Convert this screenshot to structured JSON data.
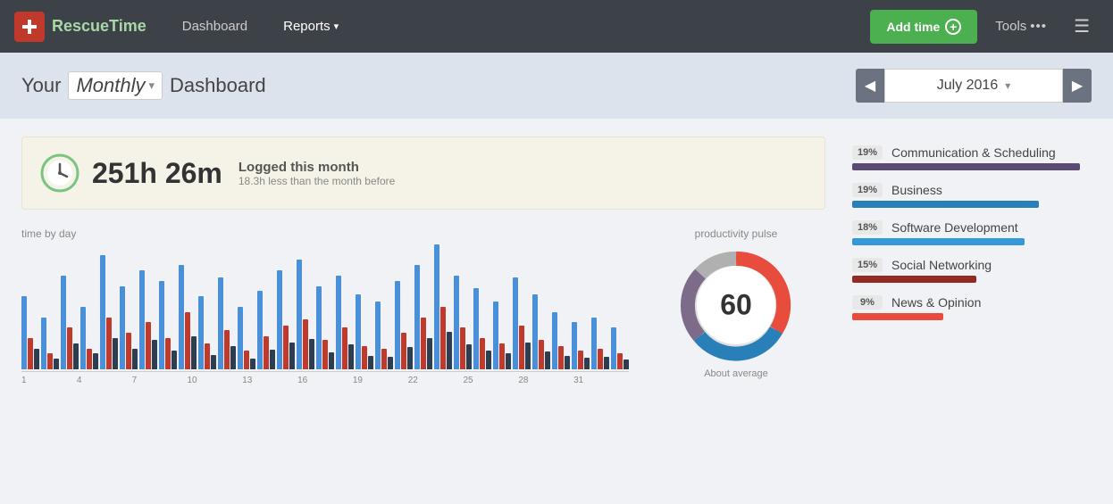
{
  "nav": {
    "logo_text_rescue": "Rescue",
    "logo_text_time": "Time",
    "links": [
      {
        "label": "Dashboard",
        "active": false
      },
      {
        "label": "Reports",
        "active": true
      }
    ],
    "add_time_label": "Add time",
    "tools_label": "Tools"
  },
  "header": {
    "prefix": "Your",
    "period_selector": "Monthly",
    "suffix": "Dashboard",
    "date": "July 2016",
    "prev_label": "◀",
    "next_label": "▶"
  },
  "summary": {
    "time": "251h 26m",
    "logged_label": "Logged this month",
    "comparison": "18.3h less than the month before"
  },
  "time_by_day": {
    "title": "time by day",
    "x_labels": [
      "1",
      "4",
      "7",
      "10",
      "13",
      "16",
      "19",
      "22",
      "25",
      "28",
      "31"
    ]
  },
  "productivity": {
    "title": "productivity pulse",
    "score": "60",
    "label": "About average"
  },
  "categories": [
    {
      "pct": "19%",
      "name": "Communication & Scheduling",
      "bar_pct": 95,
      "color": "bar-purple"
    },
    {
      "pct": "19%",
      "name": "Business",
      "bar_pct": 78,
      "color": "bar-blue-bright"
    },
    {
      "pct": "18%",
      "name": "Software Development",
      "bar_pct": 72,
      "color": "bar-blue-med"
    },
    {
      "pct": "15%",
      "name": "Social Networking",
      "bar_pct": 52,
      "color": "bar-crimson"
    },
    {
      "pct": "9%",
      "name": "News & Opinion",
      "bar_pct": 38,
      "color": "bar-red-bright"
    }
  ]
}
